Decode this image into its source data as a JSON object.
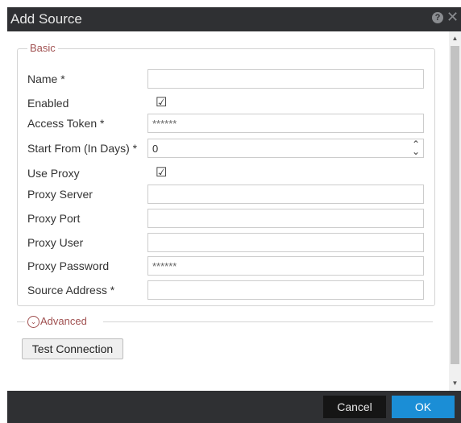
{
  "dialog": {
    "title": "Add Source",
    "help_icon": "?",
    "close_icon": "✕"
  },
  "basic": {
    "legend": "Basic",
    "fields": {
      "name": {
        "label": "Name *",
        "value": ""
      },
      "enabled": {
        "label": "Enabled",
        "checked": true,
        "mark": "☑"
      },
      "access_token": {
        "label": "Access Token *",
        "value": "******"
      },
      "start_from": {
        "label": "Start From (In Days) *",
        "value": "0"
      },
      "use_proxy": {
        "label": "Use Proxy",
        "checked": true,
        "mark": "☑"
      },
      "proxy_server": {
        "label": "Proxy Server",
        "value": ""
      },
      "proxy_port": {
        "label": "Proxy Port",
        "value": ""
      },
      "proxy_user": {
        "label": "Proxy User",
        "value": ""
      },
      "proxy_password": {
        "label": "Proxy Password",
        "value": "******"
      },
      "source_address": {
        "label": "Source Address *",
        "value": ""
      }
    }
  },
  "advanced": {
    "label": "Advanced",
    "expanded": false,
    "icon": "⌄"
  },
  "test_connection": {
    "label": "Test Connection"
  },
  "footer": {
    "cancel_label": "Cancel",
    "ok_label": "OK"
  },
  "scrollbar": {
    "up": "▲",
    "down": "▼"
  },
  "colors": {
    "titlebar": "#2f3033",
    "primary_button": "#1b8ed6",
    "section_accent": "#a05050"
  }
}
